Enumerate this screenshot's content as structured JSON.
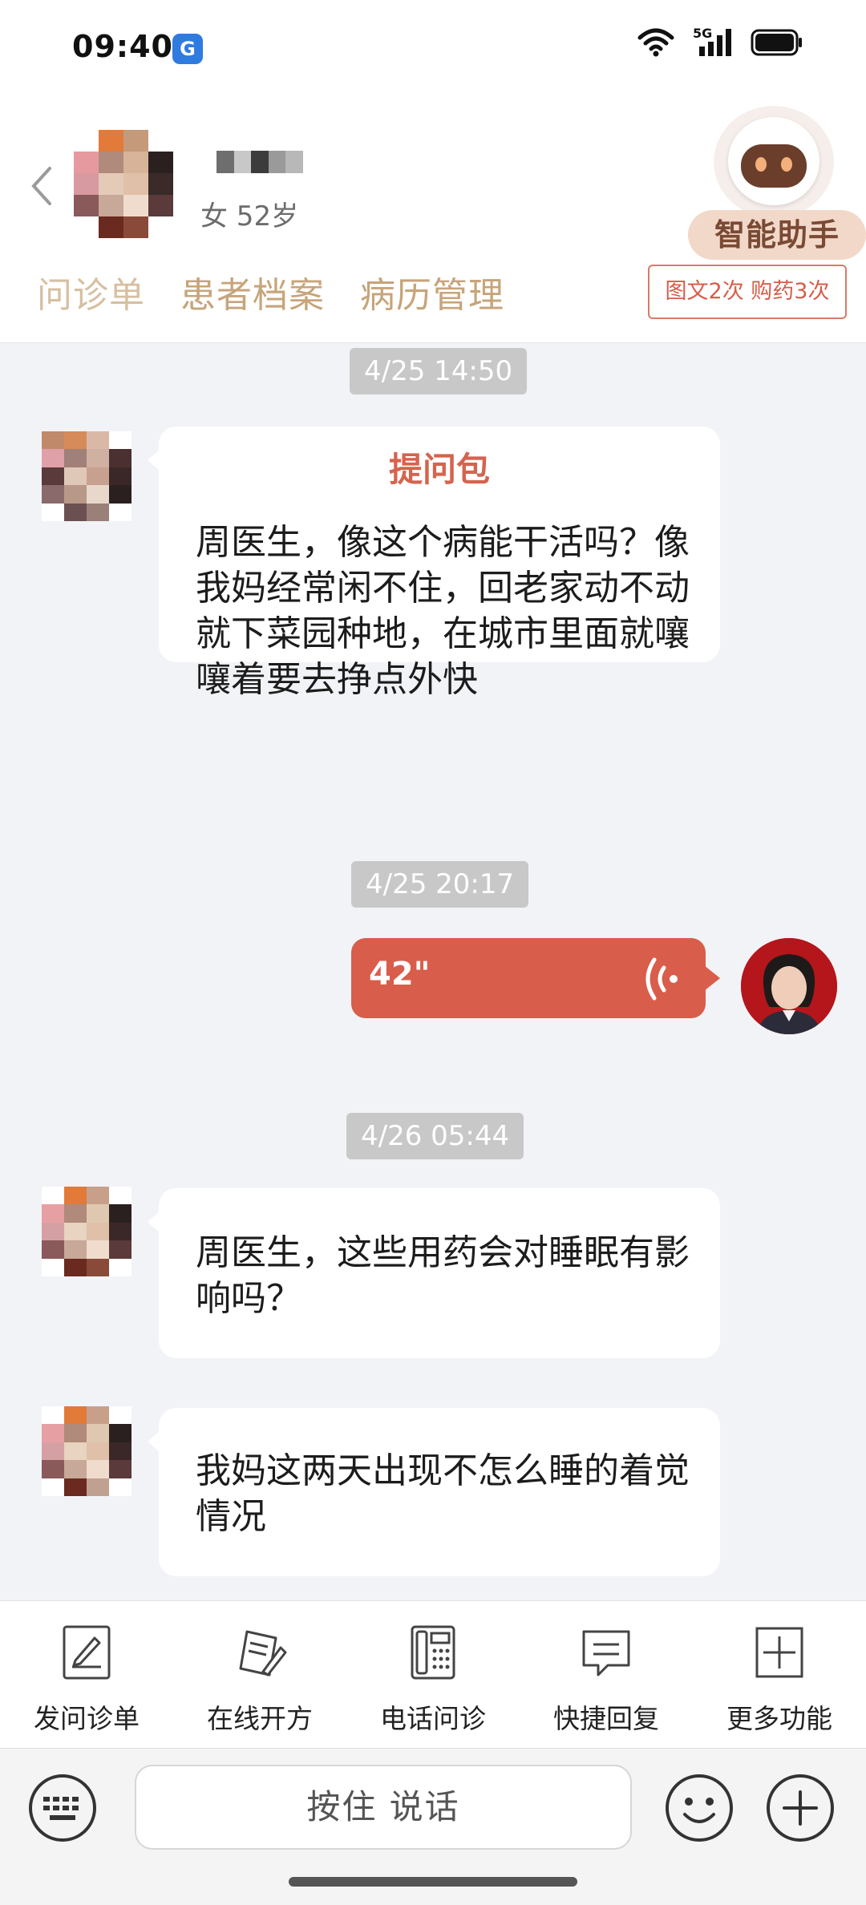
{
  "status_bar": {
    "time": "09:40",
    "app_badge": "G",
    "network": "5G"
  },
  "header": {
    "patient_info": "女 52岁",
    "tabs": [
      "问诊单",
      "患者档案",
      "病历管理"
    ],
    "quota": "图文2次 购药3次",
    "assistant_label": "智能助手"
  },
  "chat": {
    "messages": [
      {
        "time": "4/25 14:50",
        "package_title": "提问包",
        "text": "周医生，像这个病能干活吗？像我妈经常闲不住，回老家动不动就下菜园种地，在城市里面就嚷嚷着要去挣点外快"
      },
      {
        "time": "4/25 20:17",
        "voice_duration": "42\""
      },
      {
        "time": "4/26 05:44",
        "text": "周医生，这些用药会对睡眠有影响吗？"
      },
      {
        "text": "我妈这两天出现不怎么睡的着觉情况"
      }
    ]
  },
  "toolbar": {
    "items": [
      {
        "label": "发问诊单",
        "icon": "form-icon"
      },
      {
        "label": "在线开方",
        "icon": "prescription-icon"
      },
      {
        "label": "电话问诊",
        "icon": "phone-icon"
      },
      {
        "label": "快捷回复",
        "icon": "chat-reply-icon"
      },
      {
        "label": "更多功能",
        "icon": "plus-square-icon"
      }
    ]
  },
  "input": {
    "hold_to_talk": "按住 说话"
  },
  "colors": {
    "accent": "#d95d4b",
    "tab_gold": "#c7a47a"
  }
}
